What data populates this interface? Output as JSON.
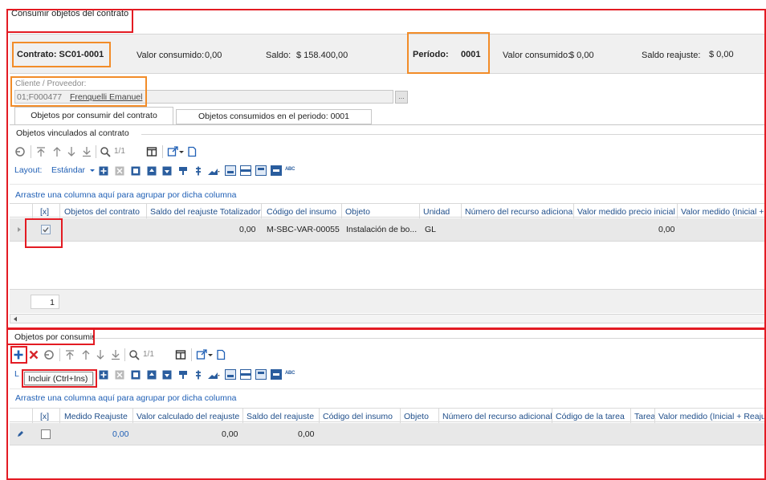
{
  "window": {
    "title": "Consumir objetos del contrato"
  },
  "contract": {
    "label": "Contrato: SC01-0001",
    "valor_consumido_label": "Valor consumido:",
    "valor_consumido": "0,00",
    "saldo_label": "Saldo:",
    "saldo": "$ 158.400,00"
  },
  "period": {
    "label": "Período:",
    "value": "0001",
    "valor_consumido_label": "Valor consumido:",
    "valor_consumido": "$ 0,00",
    "saldo_reajuste_label": "Saldo reajuste:",
    "saldo_reajuste": "$ 0,00"
  },
  "client": {
    "label": "Cliente / Proveedor:",
    "code": "01;F000477",
    "name": "Frenquelli Emanuel",
    "lookup_button": "..."
  },
  "tabs": [
    {
      "label": "Objetos por consumir del contrato"
    },
    {
      "label": "Objetos consumidos en el periodo: 0001"
    }
  ],
  "linked": {
    "section_title": "Objetos vinculados al contrato",
    "page_indicator": "1/1",
    "layout_label": "Layout:",
    "layout_value": "Estándar",
    "group_hint": "Arrastre una columna aquí para agrupar por dicha columna",
    "columns": [
      "[x]",
      "Objetos del contrato",
      "Saldo del reajuste Totalizador",
      "Código del insumo",
      "Objeto",
      "Unidad",
      "Número del recurso adicional",
      "Valor medido precio inicial",
      "Valor medido (Inicial + Re"
    ],
    "rows": [
      {
        "objetos": "",
        "saldo": "0,00",
        "codigo": "M-SBC-VAR-00055",
        "objeto": "Instalación de bo...",
        "unidad": "GL",
        "numero": "",
        "valor_medido": "0,00",
        "valor_medido_re": ""
      }
    ],
    "footer_count": "1"
  },
  "pending": {
    "section_title": "Objetos por consumir",
    "page_indicator": "1/1",
    "layout_label": "L",
    "tooltip": "Incluir (Ctrl+Ins)",
    "group_hint": "Arrastre una columna aquí para agrupar por dicha columna",
    "columns": [
      "[x]",
      "Medido Reajuste",
      "Valor calculado del reajuste",
      "Saldo del reajuste",
      "Código del insumo",
      "Objeto",
      "Número del recurso adicional",
      "Código de la tarea",
      "Tarea",
      "Valor medido (Inicial + Reaju"
    ],
    "rows": [
      {
        "medido": "0,00",
        "calculado": "0,00",
        "saldo": "0,00"
      }
    ]
  },
  "colors": {
    "highlight_red": "#e31b23",
    "highlight_orange": "#f28c28",
    "link_blue": "#1f5fb5"
  }
}
